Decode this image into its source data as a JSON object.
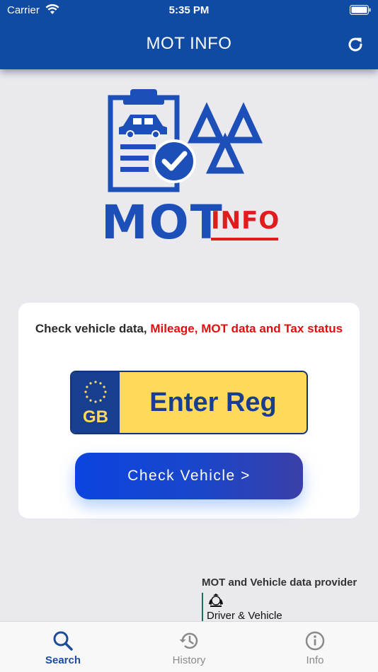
{
  "status_bar": {
    "carrier": "Carrier",
    "time": "5:35 PM"
  },
  "nav": {
    "title": "MOT INFO",
    "refresh_icon": "refresh-icon"
  },
  "logo": {
    "text_main": "MOT",
    "text_accent": "INFO"
  },
  "card": {
    "text_prefix": "Check vehicle data, ",
    "text_highlight": "Mileage, MOT data and Tax status",
    "plate": {
      "country": "GB",
      "placeholder": "Enter Reg",
      "value": ""
    },
    "check_button": "Check Vehicle >"
  },
  "provider": {
    "label": "MOT and Vehicle data provider",
    "name": "Driver & Vehicle"
  },
  "tabs": [
    {
      "label": "Search",
      "icon": "search-icon",
      "active": true
    },
    {
      "label": "History",
      "icon": "history-icon",
      "active": false
    },
    {
      "label": "Info",
      "icon": "info-icon",
      "active": false
    }
  ],
  "colors": {
    "header": "#0f4aa3",
    "accent_red": "#e00f0f",
    "plate_yellow": "#fed95a",
    "plate_blue": "#173e8f"
  }
}
